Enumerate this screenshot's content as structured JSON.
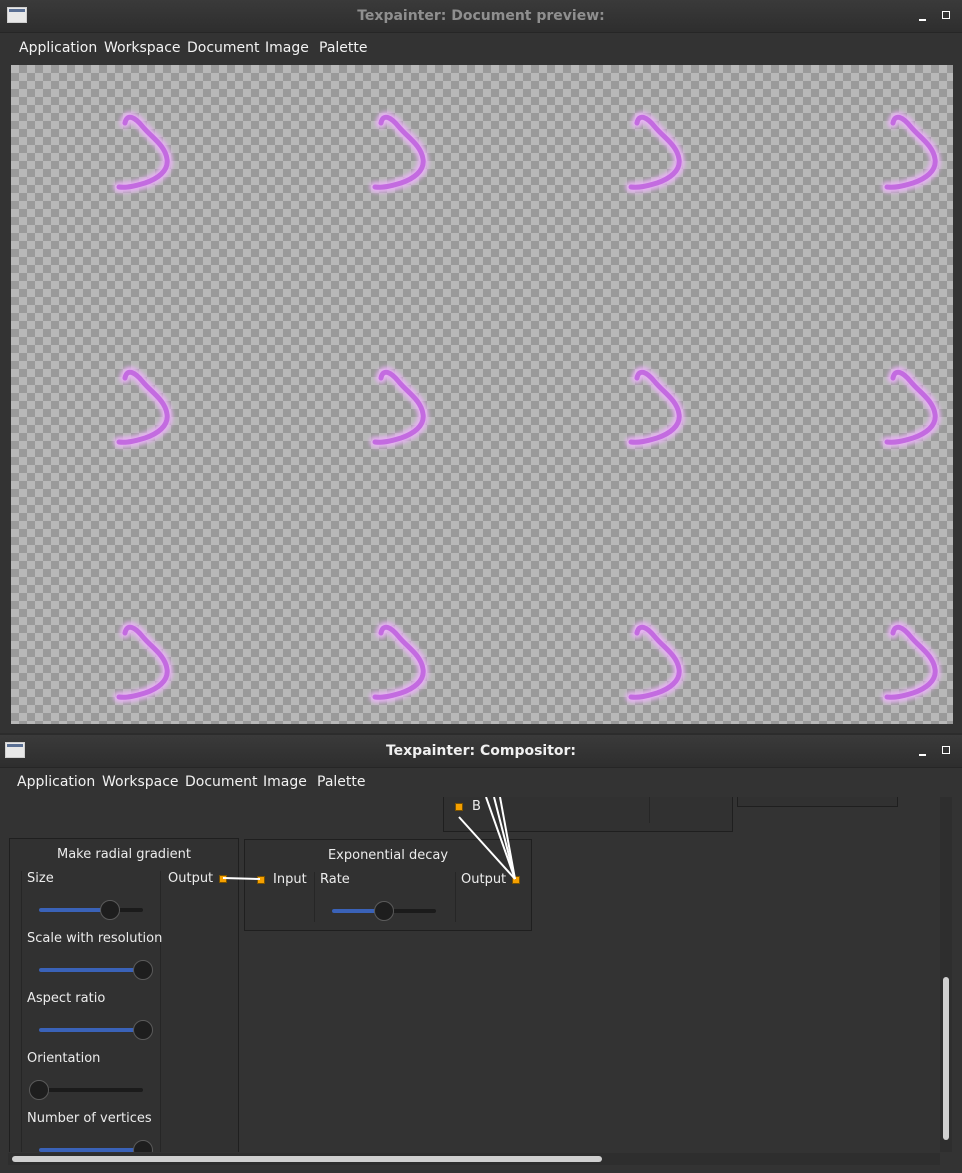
{
  "preview_window": {
    "title": "Texpainter: Document preview:",
    "menu": [
      "Application",
      "Workspace",
      "Document",
      "Image",
      "Palette"
    ]
  },
  "compositor_window": {
    "title": "Texpainter: Compositor:",
    "menu": [
      "Application",
      "Workspace",
      "Document",
      "Image",
      "Palette"
    ]
  },
  "colors": {
    "stroke": "#c36be0",
    "port": "#f5a000",
    "slider_fill": "#3a62b8"
  },
  "compositor": {
    "partial_node": {
      "port_b_label": "B"
    },
    "radial_gradient": {
      "title": "Make radial gradient",
      "output_label": "Output",
      "params": [
        {
          "label": "Size",
          "value": 0.68
        },
        {
          "label": "Scale with resolution",
          "value": 1.0
        },
        {
          "label": "Aspect ratio",
          "value": 1.0
        },
        {
          "label": "Orientation",
          "value": 0.0
        },
        {
          "label": "Number of vertices",
          "value": 1.0
        }
      ]
    },
    "exp_decay": {
      "title": "Exponential decay",
      "input_label": "Input",
      "rate_label": "Rate",
      "rate_value": 0.5,
      "output_label": "Output"
    }
  }
}
